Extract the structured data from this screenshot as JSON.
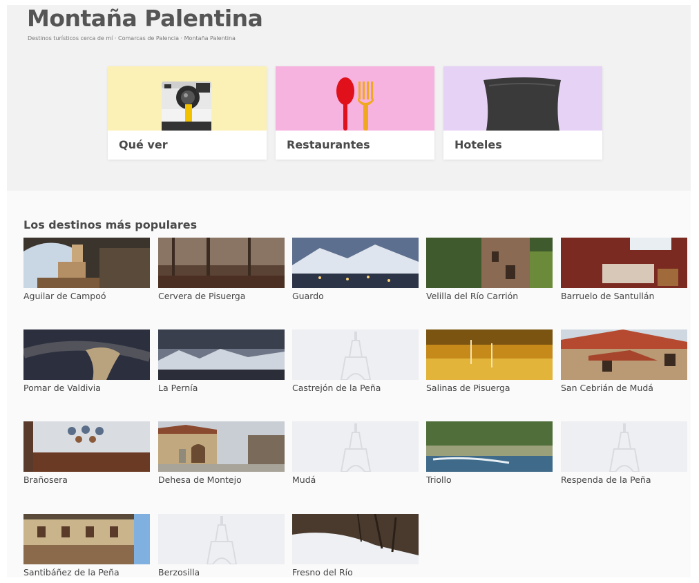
{
  "header": {
    "title": "Montaña Palentina",
    "breadcrumb": [
      "Destinos turísticos cerca de mí",
      "Comarcas de Palencia",
      "Montaña Palentina"
    ],
    "separator": " · "
  },
  "categories": [
    {
      "label": "Qué ver",
      "bg": "#fbf1b6",
      "icon": "camera-icon"
    },
    {
      "label": "Restaurantes",
      "bg": "#f7b3e0",
      "icon": "spoon-fork-icon"
    },
    {
      "label": "Hoteles",
      "bg": "#e6d2f5",
      "icon": "pillow-icon"
    }
  ],
  "popular": {
    "title": "Los destinos más populares",
    "items": [
      {
        "name": "Aguilar de Campoó",
        "photo": true
      },
      {
        "name": "Cervera de Pisuerga",
        "photo": true
      },
      {
        "name": "Guardo",
        "photo": true
      },
      {
        "name": "Velilla del Río Carrión",
        "photo": true
      },
      {
        "name": "Barruelo de Santullán",
        "photo": true
      },
      {
        "name": "Pomar de Valdivia",
        "photo": true
      },
      {
        "name": "La Pernía",
        "photo": true
      },
      {
        "name": "Castrejón de la Peña",
        "photo": false
      },
      {
        "name": "Salinas de Pisuerga",
        "photo": true
      },
      {
        "name": "San Cebrián de Mudá",
        "photo": true
      },
      {
        "name": "Brañosera",
        "photo": true
      },
      {
        "name": "Dehesa de Montejo",
        "photo": true
      },
      {
        "name": "Mudá",
        "photo": false
      },
      {
        "name": "Triollo",
        "photo": true
      },
      {
        "name": "Respenda de la Peña",
        "photo": false
      },
      {
        "name": "Santibáñez de la Peña",
        "photo": true
      },
      {
        "name": "Berzosilla",
        "photo": false
      },
      {
        "name": "Fresno del Río",
        "photo": true
      }
    ]
  }
}
